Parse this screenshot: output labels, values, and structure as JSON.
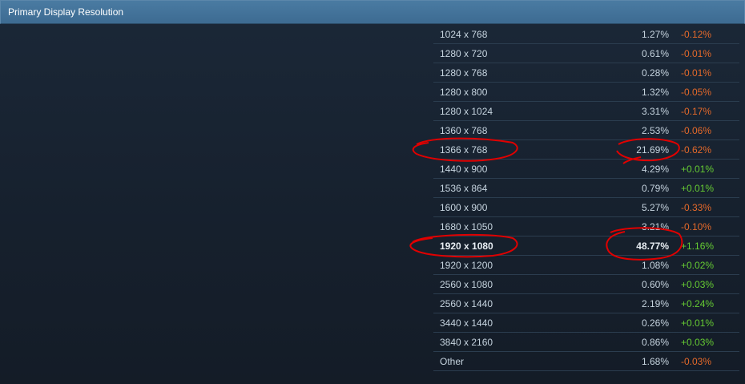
{
  "header": {
    "title": "Primary Display Resolution"
  },
  "colors": {
    "header_bg": "#3d6b92",
    "page_bg": "#1b2838",
    "negative": "#e4692a",
    "positive": "#66cc33",
    "annotation": "#e00000"
  },
  "rows": [
    {
      "resolution": "1024 x 768",
      "share": "1.27%",
      "change": "-0.12%",
      "trend": "neg"
    },
    {
      "resolution": "1280 x 720",
      "share": "0.61%",
      "change": "-0.01%",
      "trend": "neg"
    },
    {
      "resolution": "1280 x 768",
      "share": "0.28%",
      "change": "-0.01%",
      "trend": "neg"
    },
    {
      "resolution": "1280 x 800",
      "share": "1.32%",
      "change": "-0.05%",
      "trend": "neg"
    },
    {
      "resolution": "1280 x 1024",
      "share": "3.31%",
      "change": "-0.17%",
      "trend": "neg"
    },
    {
      "resolution": "1360 x 768",
      "share": "2.53%",
      "change": "-0.06%",
      "trend": "neg"
    },
    {
      "resolution": "1366 x 768",
      "share": "21.69%",
      "change": "-0.62%",
      "trend": "neg",
      "circled": true
    },
    {
      "resolution": "1440 x 900",
      "share": "4.29%",
      "change": "+0.01%",
      "trend": "pos"
    },
    {
      "resolution": "1536 x 864",
      "share": "0.79%",
      "change": "+0.01%",
      "trend": "pos"
    },
    {
      "resolution": "1600 x 900",
      "share": "5.27%",
      "change": "-0.33%",
      "trend": "neg"
    },
    {
      "resolution": "1680 x 1050",
      "share": "3.21%",
      "change": "-0.10%",
      "trend": "neg"
    },
    {
      "resolution": "1920 x 1080",
      "share": "48.77%",
      "change": "+1.16%",
      "trend": "pos",
      "bold": true,
      "circled": true
    },
    {
      "resolution": "1920 x 1200",
      "share": "1.08%",
      "change": "+0.02%",
      "trend": "pos"
    },
    {
      "resolution": "2560 x 1080",
      "share": "0.60%",
      "change": "+0.03%",
      "trend": "pos"
    },
    {
      "resolution": "2560 x 1440",
      "share": "2.19%",
      "change": "+0.24%",
      "trend": "pos"
    },
    {
      "resolution": "3440 x 1440",
      "share": "0.26%",
      "change": "+0.01%",
      "trend": "pos"
    },
    {
      "resolution": "3840 x 2160",
      "share": "0.86%",
      "change": "+0.03%",
      "trend": "pos"
    },
    {
      "resolution": "Other",
      "share": "1.68%",
      "change": "-0.03%",
      "trend": "neg"
    }
  ]
}
